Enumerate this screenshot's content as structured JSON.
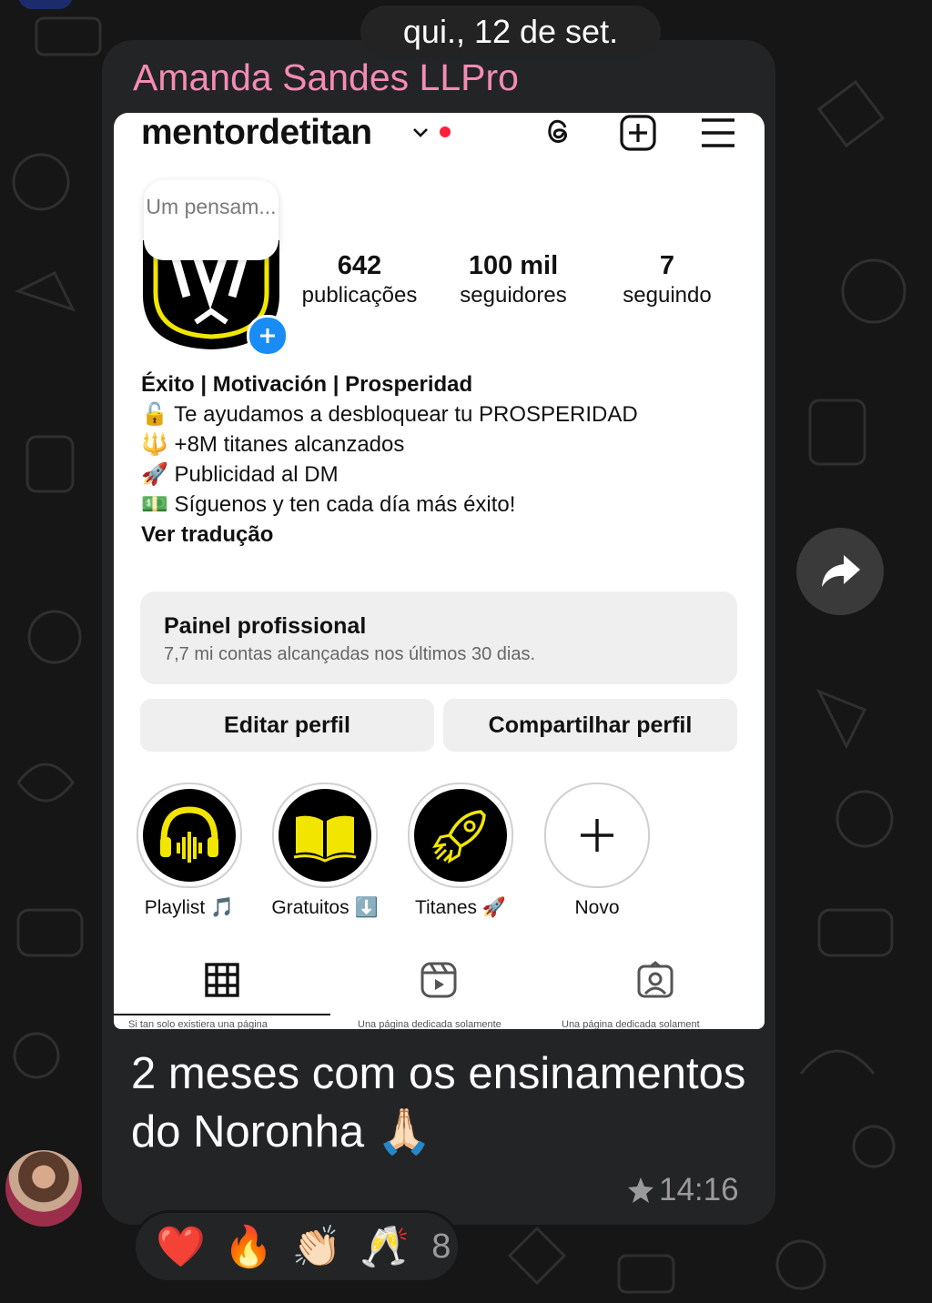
{
  "chat": {
    "date_pill": "qui., 12 de set.",
    "sender": "Amanda Sandes LLPro",
    "caption": "2 meses com os ensinamentos do Noronha 🙏🏻",
    "time": "14:16",
    "star_icon": "star-icon",
    "reactions": [
      "❤️",
      "🔥",
      "👏🏻",
      "🥂"
    ],
    "reaction_count": "8"
  },
  "instagram": {
    "username": "mentordetitan",
    "thought_bubble": "Um pensam...",
    "stats": [
      {
        "num": "642",
        "label": "publicações"
      },
      {
        "num": "100 mil",
        "label": "seguidores"
      },
      {
        "num": "7",
        "label": "seguindo"
      }
    ],
    "bio": {
      "title": "Éxito | Motivación | Prosperidad",
      "line1": "🔓 Te ayudamos a desbloquear tu PROSPERIDAD",
      "line2": "🔱 +8M titanes alcanzados",
      "line3": "🚀 Publicidad al DM",
      "line4": "💵 Síguenos y ten cada día más éxito!",
      "translate": "Ver tradução"
    },
    "pro_panel": {
      "title": "Painel profissional",
      "subtitle": "7,7 mi contas alcançadas nos últimos 30 dias."
    },
    "buttons": {
      "edit": "Editar perfil",
      "share": "Compartilhar perfil"
    },
    "highlights": [
      {
        "label": "Playlist 🎵"
      },
      {
        "label": "Gratuitos ⬇️"
      },
      {
        "label": "Titanes 🚀"
      },
      {
        "label": "Novo"
      }
    ],
    "grid_peek": [
      "Si tan solo existiera una página",
      "Una página dedicada solamente",
      "Una página dedicada solament"
    ]
  }
}
